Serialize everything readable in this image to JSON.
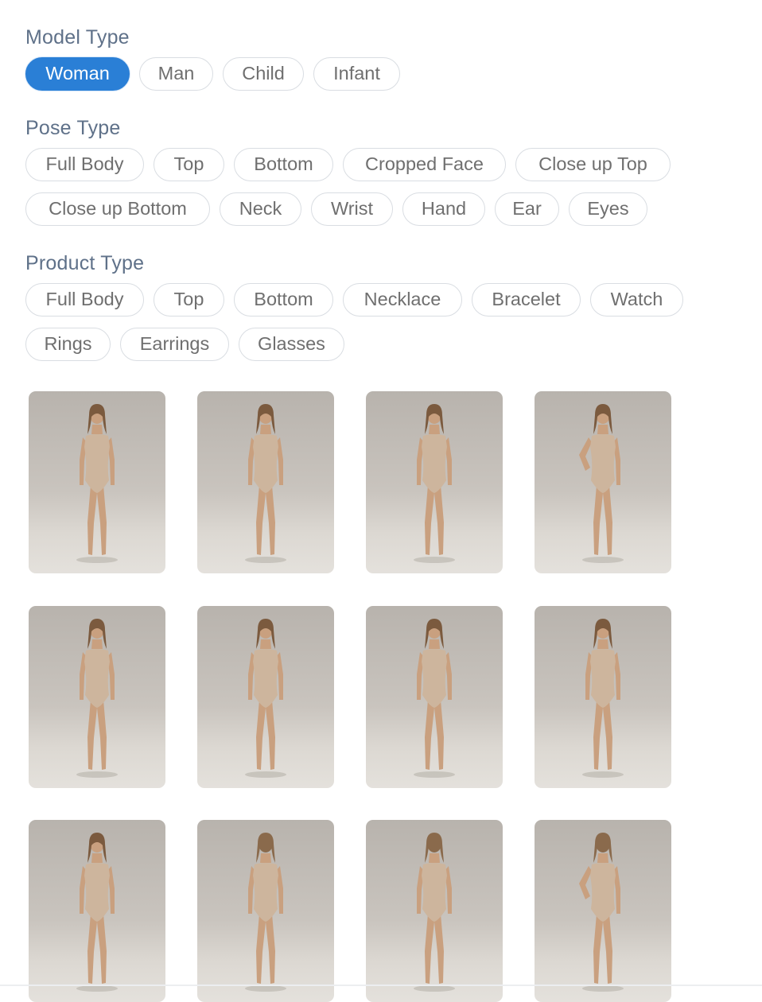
{
  "model_type": {
    "title": "Model Type",
    "options": [
      "Woman",
      "Man",
      "Child",
      "Infant"
    ],
    "selected": "Woman"
  },
  "pose_type": {
    "title": "Pose Type",
    "options": [
      "Full Body",
      "Top",
      "Bottom",
      "Cropped Face",
      "Close up Top",
      "Close up Bottom",
      "Neck",
      "Wrist",
      "Hand",
      "Ear",
      "Eyes"
    ]
  },
  "product_type": {
    "title": "Product Type",
    "options": [
      "Full Body",
      "Top",
      "Bottom",
      "Necklace",
      "Bracelet",
      "Watch",
      "Rings",
      "Earrings",
      "Glasses"
    ]
  },
  "gallery": {
    "items": [
      {
        "view": "front"
      },
      {
        "view": "front"
      },
      {
        "view": "front"
      },
      {
        "view": "front-hand-on-hip"
      },
      {
        "view": "front"
      },
      {
        "view": "front"
      },
      {
        "view": "front"
      },
      {
        "view": "front"
      },
      {
        "view": "front"
      },
      {
        "view": "back"
      },
      {
        "view": "back"
      },
      {
        "view": "back-hand-on-hip"
      }
    ]
  },
  "colors": {
    "accent": "#2a7fd6",
    "section_title": "#5f7189",
    "chip_border": "#d9dde2",
    "chip_text": "#6f6f6f"
  }
}
